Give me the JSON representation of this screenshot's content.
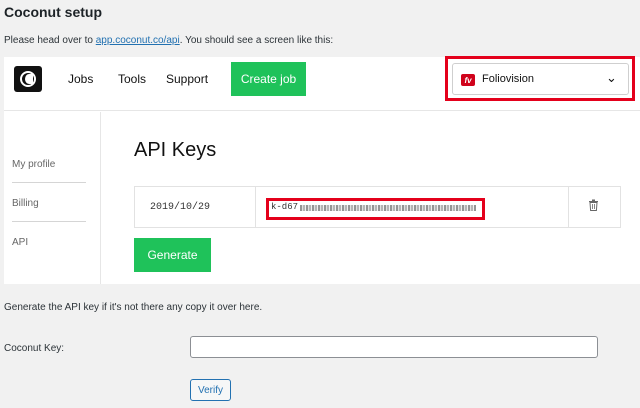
{
  "header": {
    "title": "Coconut setup",
    "intro_prefix": "Please head over to ",
    "intro_link": "app.coconut.co/api",
    "intro_suffix": ". You should see a screen like this:"
  },
  "screenshot": {
    "nav": [
      "Jobs",
      "Tools",
      "Support"
    ],
    "create_job": "Create job",
    "account": {
      "badge": "fv",
      "name": "Foliovision"
    },
    "sidebar": [
      "My profile",
      "Billing",
      "API"
    ],
    "api_title": "API Keys",
    "key_row": {
      "date": "2019/10/29",
      "key_prefix": "k-d67"
    },
    "generate": "Generate"
  },
  "form": {
    "note": "Generate the API key if it's not there any copy it over here.",
    "label": "Coconut Key:",
    "input_value": "",
    "verify": "Verify"
  },
  "colors": {
    "accent_green": "#1fc25a",
    "highlight_red": "#e4001b",
    "link_blue": "#2271b1"
  }
}
